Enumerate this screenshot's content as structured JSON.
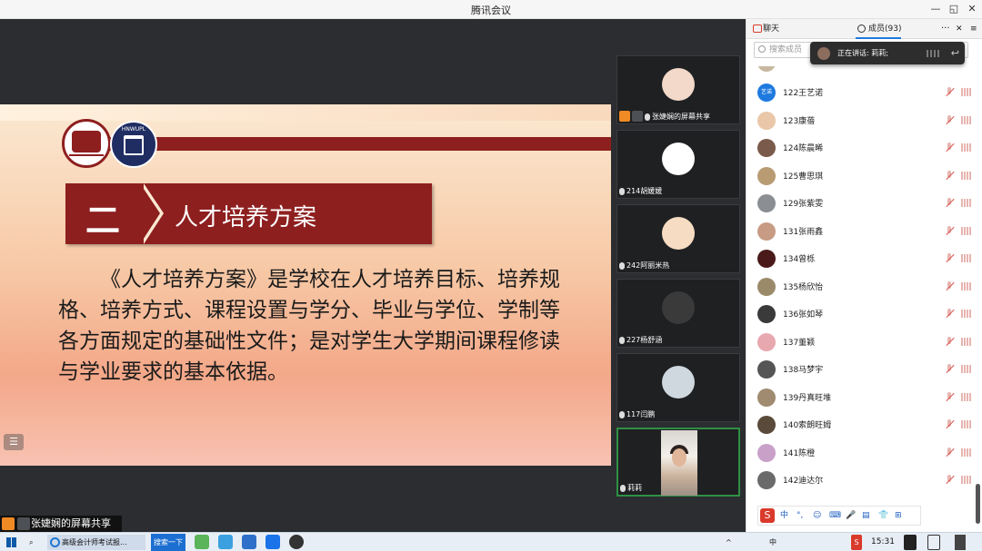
{
  "window": {
    "title": "腾讯会议",
    "minimize": "—",
    "restore": "◱",
    "close": "✕"
  },
  "slide": {
    "heading_number": "二",
    "heading_text": "人才培养方案",
    "body": "《人才培养方案》是学校在人才培养目标、培养规格、培养方式、课程设置与学分、毕业与学位、学制等各方面规定的基础性文件；是对学生大学期间课程修读与学业要求的基本依据。",
    "logo2_caption": "HNWUPL",
    "menu_icon": "☰"
  },
  "share_bar": {
    "label": "张婕娴的屏幕共享"
  },
  "video_tiles": [
    {
      "label": "张婕娴的屏幕共享",
      "avatar_color": "#f2d9c9"
    },
    {
      "label": "214胡媛媛",
      "avatar_color": "#ffffff"
    },
    {
      "label": "242阿丽米热",
      "avatar_color": "#f6dcc2"
    },
    {
      "label": "227杨舒涵",
      "avatar_color": "#3a3a3a"
    },
    {
      "label": "117闫鹏",
      "avatar_color": "#cfd8de"
    },
    {
      "label": "莉莉",
      "avatar_color": "#e0b79a"
    }
  ],
  "panel": {
    "tab_chat": "聊天",
    "tab_members": "成员(93)",
    "more": "···",
    "close": "✕",
    "menu": "≡",
    "search_placeholder": "搜索成员",
    "speaking": "正在讲话: 莉莉;",
    "members": [
      {
        "name": "122王艺诺",
        "avatar_text": "艺诺",
        "color": "#1f7ae0"
      },
      {
        "name": "123康蓓",
        "avatar_text": "",
        "color": "#e9c7a8"
      },
      {
        "name": "124陈晨晞",
        "avatar_text": "",
        "color": "#7a5a4a"
      },
      {
        "name": "125曹思琪",
        "avatar_text": "",
        "color": "#b89b73"
      },
      {
        "name": "129张紫雯",
        "avatar_text": "",
        "color": "#8b8f93"
      },
      {
        "name": "131张雨鑫",
        "avatar_text": "",
        "color": "#c79b84"
      },
      {
        "name": "134曾栎",
        "avatar_text": "",
        "color": "#4a1a1a"
      },
      {
        "name": "135杨欣怡",
        "avatar_text": "",
        "color": "#9b8a6a"
      },
      {
        "name": "136张如琴",
        "avatar_text": "",
        "color": "#3a3a3a"
      },
      {
        "name": "137董颖",
        "avatar_text": "",
        "color": "#e8a8b0"
      },
      {
        "name": "138马梦宇",
        "avatar_text": "",
        "color": "#555555"
      },
      {
        "name": "139丹真旺堆",
        "avatar_text": "",
        "color": "#a08a70"
      },
      {
        "name": "140索朗旺姆",
        "avatar_text": "",
        "color": "#5a4a3a"
      },
      {
        "name": "141陈橙",
        "avatar_text": "",
        "color": "#c8a0c8"
      },
      {
        "name": "142迪达尔",
        "avatar_text": "",
        "color": "#6a6a6a"
      }
    ],
    "ime_items": [
      "中",
      "°,",
      "☺",
      "⌨",
      "🎤",
      "▤",
      "👕",
      "⊞"
    ]
  },
  "taskbar": {
    "app_label": "高级会计师考试报...",
    "search_label": "搜索一下",
    "clock": "15:31",
    "tray": [
      "^",
      "中",
      "S"
    ]
  }
}
